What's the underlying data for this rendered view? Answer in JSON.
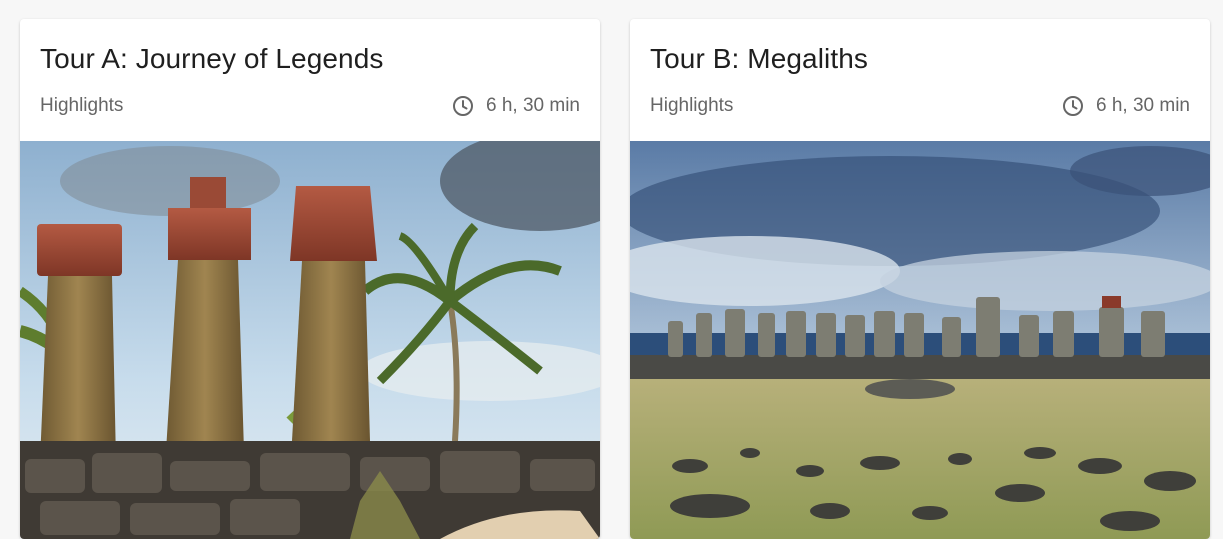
{
  "tours": [
    {
      "title": "Tour A: Journey of Legends",
      "subtitle": "Highlights",
      "duration": "6 h, 30 min",
      "image_alt": "Moai statues with red topknots and palm trees"
    },
    {
      "title": "Tour B: Megaliths",
      "subtitle": "Highlights",
      "duration": "6 h, 30 min",
      "image_alt": "Row of fifteen moai on a platform by the sea"
    }
  ],
  "colors": {
    "text_primary": "#1f1f1f",
    "text_secondary": "#666666",
    "card_bg": "#ffffff",
    "page_bg": "#f7f7f7"
  },
  "icons": {
    "duration": "clock-icon"
  }
}
